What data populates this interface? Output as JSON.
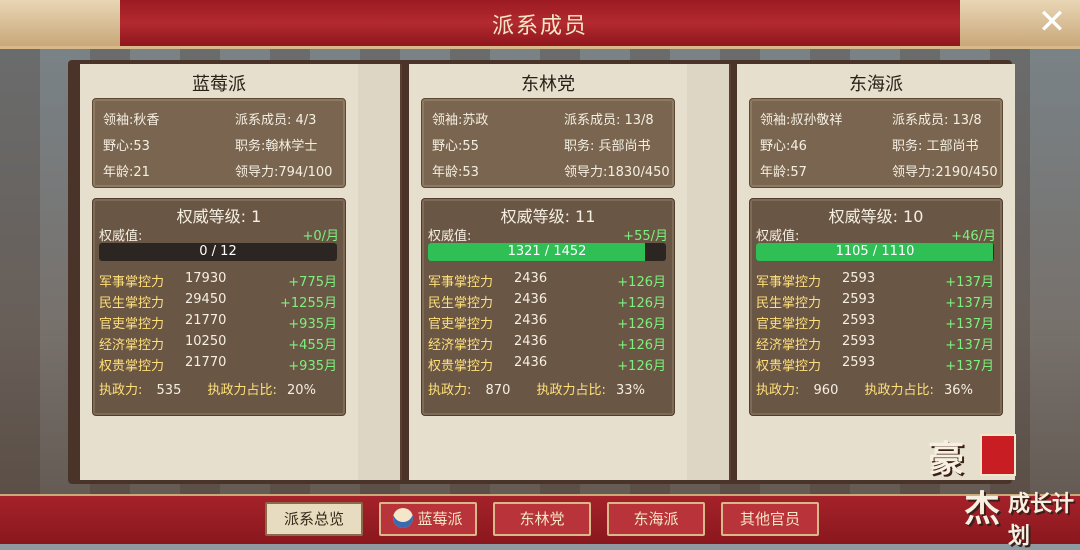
{
  "title": "派系成员",
  "factions": [
    {
      "name": "蓝莓派",
      "leader": "领袖:秋香",
      "members": "派系成员: 4/3",
      "ambition": "野心:53",
      "post": "职务:翰林学士",
      "age": "年龄:21",
      "leadership": "领导力:794/100",
      "level_label": "权威等级:  1",
      "authority_label": "权威值:",
      "authority_gain": "+0/月",
      "authority_text": "0 / 12",
      "authority_fraction": 0.0,
      "controls": [
        {
          "name": "军事掌控力",
          "value": "17930",
          "gain": "+775月"
        },
        {
          "name": "民生掌控力",
          "value": "29450",
          "gain": "+1255月"
        },
        {
          "name": "官吏掌控力",
          "value": "21770",
          "gain": "+935月"
        },
        {
          "name": "经济掌控力",
          "value": "10250",
          "gain": "+455月"
        },
        {
          "name": "权贵掌控力",
          "value": "21770",
          "gain": "+935月"
        }
      ],
      "exec_label": "执政力:",
      "exec_value": "535",
      "exec_share_label": "执政力占比:",
      "exec_share": "20%"
    },
    {
      "name": "东林党",
      "leader": "领袖:苏政",
      "members": "派系成员: 13/8",
      "ambition": "野心:55",
      "post": "职务: 兵部尚书",
      "age": "年龄:53",
      "leadership": "领导力:1830/450",
      "level_label": "权威等级:  11",
      "authority_label": "权威值:",
      "authority_gain": "+55/月",
      "authority_text": "1321 / 1452",
      "authority_fraction": 0.91,
      "controls": [
        {
          "name": "军事掌控力",
          "value": "2436",
          "gain": "+126月"
        },
        {
          "name": "民生掌控力",
          "value": "2436",
          "gain": "+126月"
        },
        {
          "name": "官吏掌控力",
          "value": "2436",
          "gain": "+126月"
        },
        {
          "name": "经济掌控力",
          "value": "2436",
          "gain": "+126月"
        },
        {
          "name": "权贵掌控力",
          "value": "2436",
          "gain": "+126月"
        }
      ],
      "exec_label": "执政力:",
      "exec_value": "870",
      "exec_share_label": "执政力占比:",
      "exec_share": "33%"
    },
    {
      "name": "东海派",
      "leader": "领袖:叔孙敬祥",
      "members": "派系成员: 13/8",
      "ambition": "野心:46",
      "post": "职务: 工部尚书",
      "age": "年龄:57",
      "leadership": "领导力:2190/450",
      "level_label": "权威等级:  10",
      "authority_label": "权威值:",
      "authority_gain": "+46/月",
      "authority_text": "1105 / 1110",
      "authority_fraction": 0.995,
      "controls": [
        {
          "name": "军事掌控力",
          "value": "2593",
          "gain": "+137月"
        },
        {
          "name": "民生掌控力",
          "value": "2593",
          "gain": "+137月"
        },
        {
          "name": "官吏掌控力",
          "value": "2593",
          "gain": "+137月"
        },
        {
          "name": "经济掌控力",
          "value": "2593",
          "gain": "+137月"
        },
        {
          "name": "权贵掌控力",
          "value": "2593",
          "gain": "+137月"
        }
      ],
      "exec_label": "执政力:",
      "exec_value": "960",
      "exec_share_label": "执政力占比:",
      "exec_share": "36%"
    }
  ],
  "tabs": [
    "派系总览",
    "蓝莓派",
    "东林党",
    "东海派",
    "其他官员"
  ],
  "logo": {
    "line1": "豪杰",
    "line2": "成长计划"
  },
  "colors": {
    "banner": "#b32a2f",
    "bar_fill": "#2fbf55",
    "gain": "#7ef07e",
    "control_name": "#ffe07a"
  },
  "icons": {
    "close": "close-icon",
    "avatar": "avatar-icon"
  }
}
